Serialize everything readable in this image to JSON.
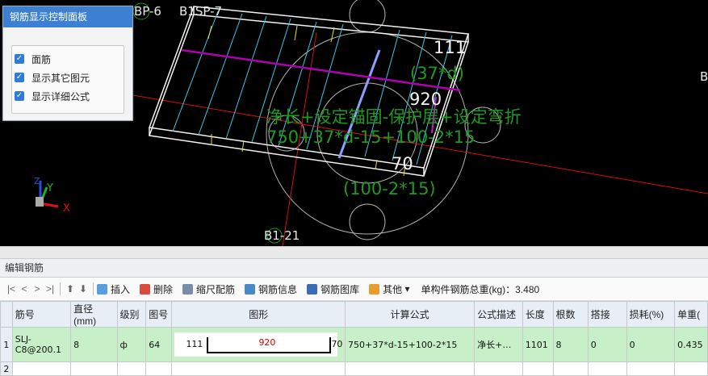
{
  "viewport": {
    "labels": {
      "bp6": "BP-6",
      "b1sp7": "B1SP-7",
      "b121": "B1-21",
      "edge_b": "B",
      "left_len": "111",
      "left_formula": "(37*d)",
      "mid_len": "920",
      "main_formula_1": "净长+设定锚固-保护层+设定弯折",
      "main_formula_2": "750+37*d-15+100-2*15",
      "right_len": "70",
      "right_formula": "(100-2*15)"
    },
    "axes": {
      "x": "X",
      "y": "Y",
      "z": "Z"
    },
    "colors": {
      "rebar_green": "#1f9a1f",
      "magenta": "#b000b0",
      "cyan": "#33c8e8"
    }
  },
  "panel": {
    "title": "钢筋显示控制面板",
    "options": [
      {
        "label": "面筋",
        "checked": true
      },
      {
        "label": "显示其它图元",
        "checked": true
      },
      {
        "label": "显示详细公式",
        "checked": true
      }
    ]
  },
  "editor": {
    "title": "编辑钢筋",
    "toolbar": {
      "nav": [
        "|<",
        "<",
        ">",
        ">|"
      ],
      "insert": "插入",
      "delete": "删除",
      "scale": "缩尺配筋",
      "info": "钢筋信息",
      "library": "钢筋图库",
      "other": "其他",
      "weight": "单构件钢筋总重(kg)：3.480"
    },
    "columns": [
      "筋号",
      "直径(mm)",
      "级别",
      "图号",
      "图形",
      "计算公式",
      "公式描述",
      "长度",
      "根数",
      "搭接",
      "损耗(%)",
      "单重("
    ],
    "rows": [
      {
        "num": "1",
        "name": "SLJ-C8@200.1",
        "diameter": "8",
        "grade": "ф",
        "fig": "64",
        "shape_left": "111",
        "shape_mid": "920",
        "shape_right": "70",
        "formula": "750+37*d-15+100-2*15",
        "desc": "净长+…",
        "length": "1101",
        "count": "8",
        "lap": "0",
        "loss": "0",
        "unit_weight": "0.435"
      }
    ],
    "row2_num": "2"
  }
}
